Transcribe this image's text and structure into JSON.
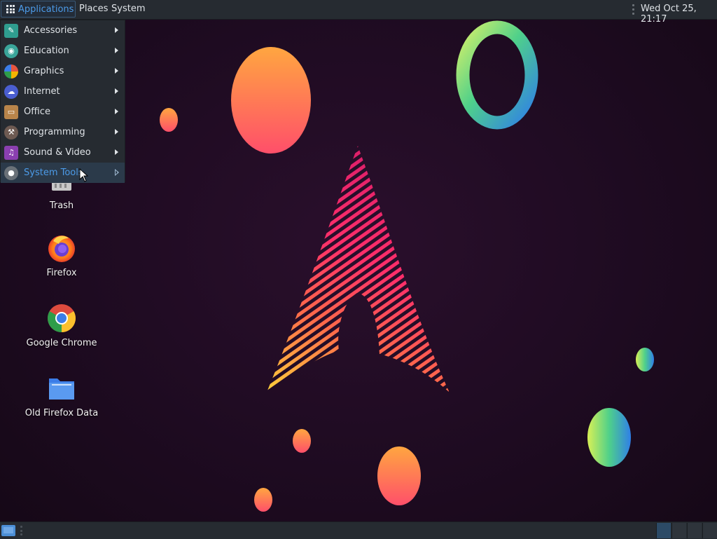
{
  "top_panel": {
    "applications_label": "Applications",
    "places_label": "Places",
    "system_label": "System",
    "clock": "Wed Oct 25, 21:17"
  },
  "apps_menu": {
    "items": [
      {
        "label": "Accessories",
        "icon": "accessories-icon",
        "color": "#2f9d8f"
      },
      {
        "label": "Education",
        "icon": "education-icon",
        "color": "#3aa59a"
      },
      {
        "label": "Graphics",
        "icon": "graphics-icon",
        "color": "#e8553f"
      },
      {
        "label": "Internet",
        "icon": "internet-icon",
        "color": "#4a5ed0"
      },
      {
        "label": "Office",
        "icon": "office-icon",
        "color": "#b8844a"
      },
      {
        "label": "Programming",
        "icon": "programming-icon",
        "color": "#6d5a52"
      },
      {
        "label": "Sound & Video",
        "icon": "sound-video-icon",
        "color": "#8a3fb0"
      },
      {
        "label": "System Tools",
        "icon": "system-tools-icon",
        "color": "#6a7178",
        "active": true
      }
    ]
  },
  "desktop_icons": [
    {
      "label": "Trash",
      "icon": "trash-icon"
    },
    {
      "label": "Firefox",
      "icon": "firefox-icon"
    },
    {
      "label": "Google Chrome",
      "icon": "chrome-icon"
    },
    {
      "label": "Old Firefox Data",
      "icon": "folder-icon"
    }
  ],
  "colors": {
    "accent": "#4c9be8",
    "panel_bg": "#262b31",
    "menu_text": "#dfe3e7",
    "desktop_bg": "#1e0b21"
  }
}
